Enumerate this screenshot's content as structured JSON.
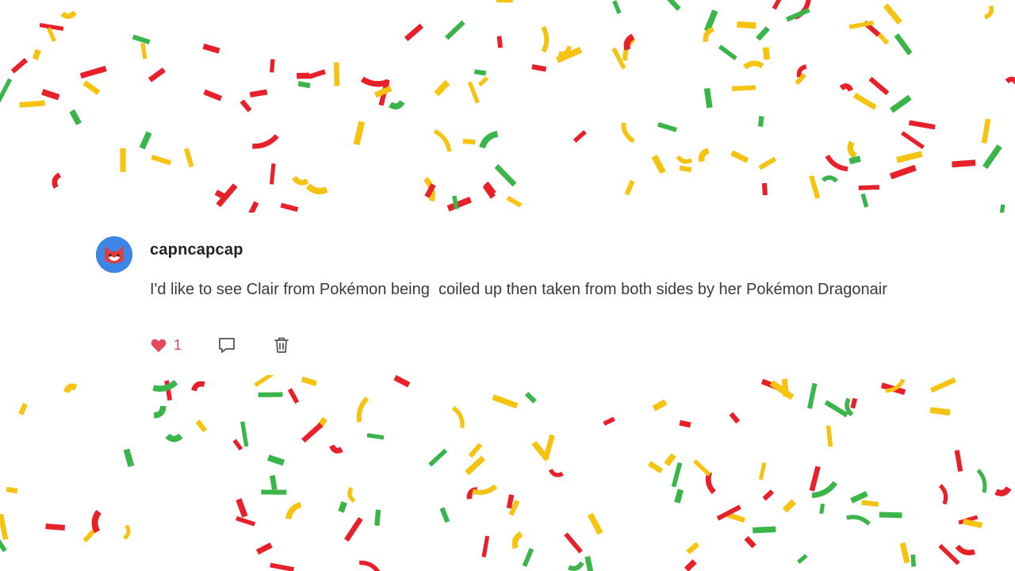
{
  "confetti_colors": [
    "#e8202a",
    "#f5c310",
    "#3ab54a"
  ],
  "comment": {
    "username": "capncapcap",
    "text": "I'd like to see Clair from Pokémon being  coiled up then taken from both sides by her Pokémon Dragonair",
    "likes": "1",
    "like_color": "#e24a5c",
    "icons": {
      "avatar": "red-cat-mask-avatar",
      "like": "heart-icon",
      "reply": "comment-bubble-icon",
      "delete": "trash-icon"
    }
  }
}
